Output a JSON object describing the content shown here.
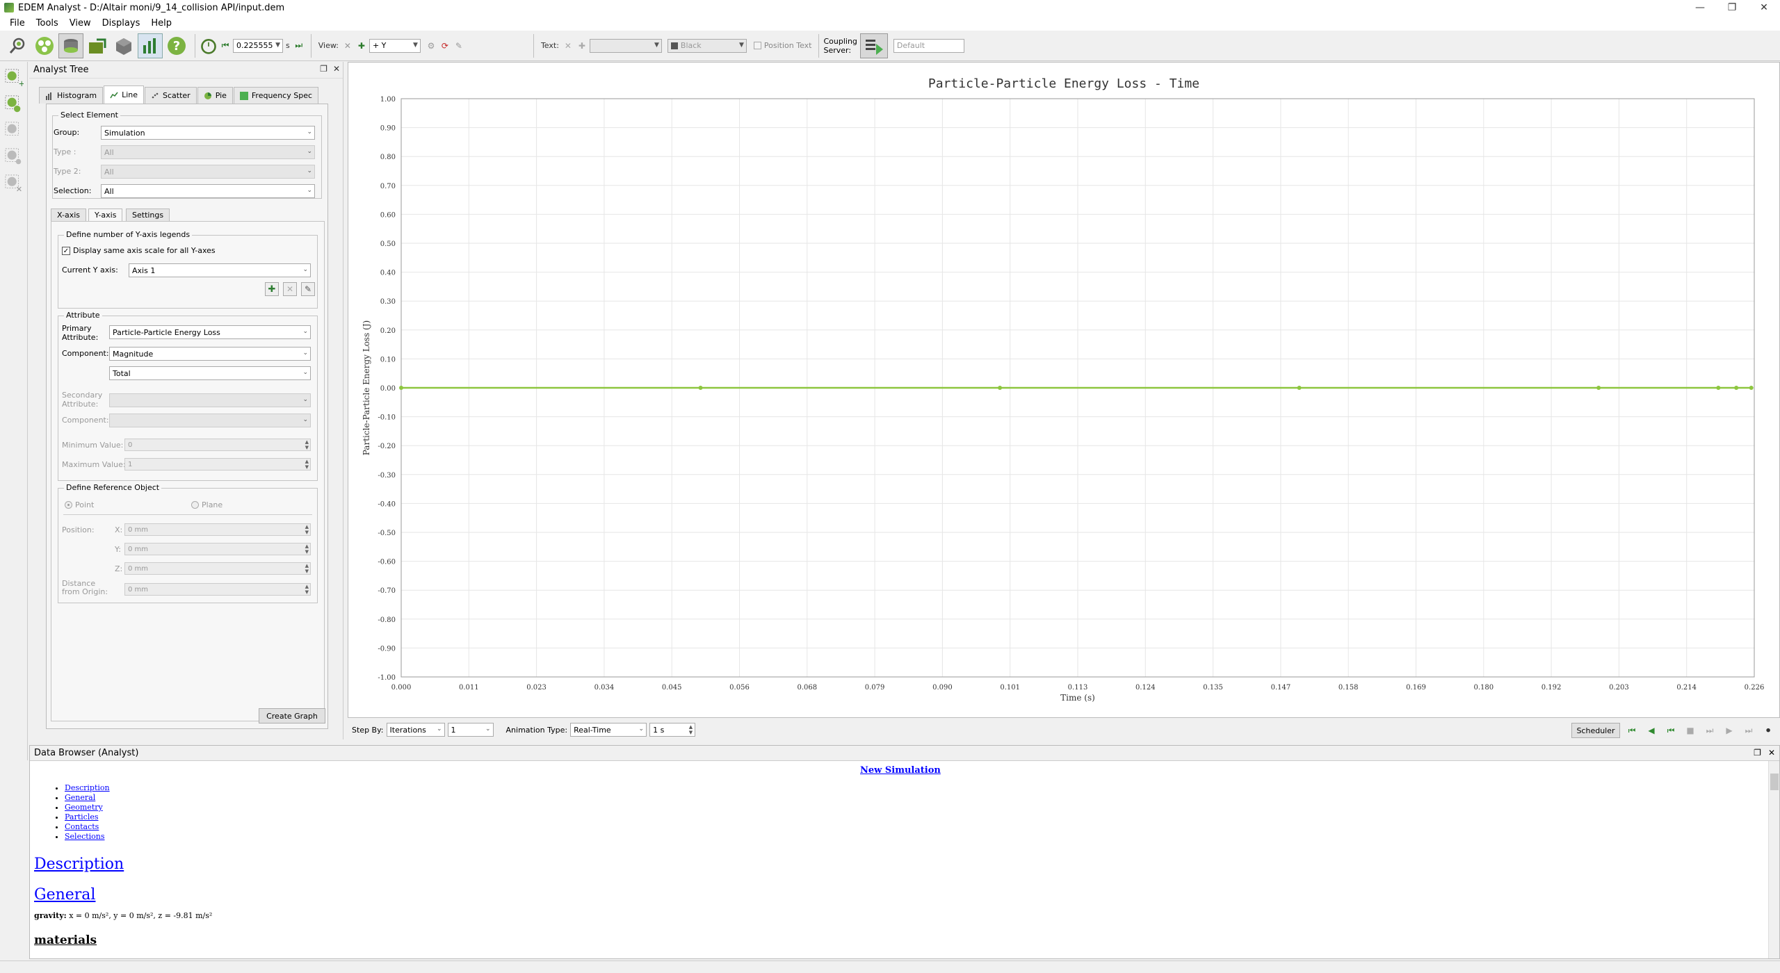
{
  "window": {
    "title": "EDEM Analyst - D:/Altair moni/9_14_collision API/input.dem"
  },
  "menu": [
    "File",
    "Tools",
    "View",
    "Displays",
    "Help"
  ],
  "toolbar": {
    "time_value": "0.225555",
    "time_unit": "s",
    "view_label": "View:",
    "view_axis": "+ Y",
    "text_label": "Text:",
    "color_value": "Black",
    "position_text_label": "Position Text",
    "coupling_label_1": "Coupling",
    "coupling_label_2": "Server:",
    "server_value": "Default"
  },
  "analyst_tree": {
    "title": "Analyst Tree",
    "tabs": [
      "Histogram",
      "Line",
      "Scatter",
      "Pie",
      "Frequency Spec"
    ],
    "active_tab": "Line",
    "select_element": {
      "title": "Select Element",
      "group_label": "Group:",
      "group_value": "Simulation",
      "type_label": "Type :",
      "type_value": "All",
      "type2_label": "Type 2:",
      "type2_value": "All",
      "selection_label": "Selection:",
      "selection_value": "All"
    },
    "axis_tabs": [
      "X-axis",
      "Y-axis",
      "Settings"
    ],
    "active_axis_tab": "Y-axis",
    "y_legends": {
      "title": "Define number of Y-axis legends",
      "checkbox_label": "Display same axis scale for all Y-axes",
      "current_label": "Current Y axis:",
      "current_value": "Axis 1"
    },
    "attribute": {
      "title": "Attribute",
      "primary_label_1": "Primary",
      "primary_label_2": "Attribute:",
      "primary_value": "Particle-Particle Energy Loss",
      "component_label": "Component:",
      "component_value": "Magnitude",
      "component2_value": "Total",
      "secondary_label_1": "Secondary",
      "secondary_label_2": "Attribute:",
      "secondary_component_label": "Component:",
      "min_label": "Minimum Value:",
      "min_value": "0",
      "max_label": "Maximum Value:",
      "max_value": "1"
    },
    "reference": {
      "title": "Define Reference Object",
      "point_label": "Point",
      "plane_label": "Plane",
      "position_label": "Position:",
      "x_label": "X:",
      "x_value": "0 mm",
      "y_label": "Y:",
      "y_value": "0 mm",
      "z_label": "Z:",
      "z_value": "0 mm",
      "distance_label_1": "Distance",
      "distance_label_2": "from Origin:",
      "distance_value": "0 mm"
    },
    "create_graph": "Create Graph"
  },
  "chart_data": {
    "type": "line",
    "title": "Particle-Particle Energy Loss - Time",
    "xlabel": "Time (s)",
    "ylabel": "Particle-Particle Energy Loss (J)",
    "xlim": [
      0.0,
      0.226
    ],
    "ylim": [
      -1.0,
      1.0
    ],
    "x_ticks": [
      "0.000",
      "0.011",
      "0.023",
      "0.034",
      "0.045",
      "0.056",
      "0.068",
      "0.079",
      "0.090",
      "0.101",
      "0.113",
      "0.124",
      "0.135",
      "0.147",
      "0.158",
      "0.169",
      "0.180",
      "0.192",
      "0.203",
      "0.214",
      "0.226"
    ],
    "y_ticks": [
      "1.00",
      "0.90",
      "0.80",
      "0.70",
      "0.60",
      "0.50",
      "0.40",
      "0.30",
      "0.20",
      "0.10",
      "0.00",
      "-0.10",
      "-0.20",
      "-0.30",
      "-0.40",
      "-0.50",
      "-0.60",
      "-0.70",
      "-0.80",
      "-0.90",
      "-1.00"
    ],
    "grid": true,
    "series": [
      {
        "color": "#8dc63f",
        "x": [
          0.0,
          0.05,
          0.1,
          0.15,
          0.2,
          0.22,
          0.223,
          0.2255
        ],
        "y": [
          0,
          0,
          0,
          0,
          0,
          0,
          0,
          0
        ]
      }
    ]
  },
  "playbar": {
    "step_by_label": "Step By:",
    "step_by_value": "Iterations",
    "step_value": "1",
    "anim_label": "Animation Type:",
    "anim_value": "Real-Time",
    "anim_interval": "1 s",
    "scheduler": "Scheduler"
  },
  "data_browser": {
    "title": "Data Browser (Analyst)",
    "heading": "New Simulation",
    "toc": [
      "Description",
      "General",
      "Geometry",
      "Particles",
      "Contacts",
      "Selections"
    ],
    "section_description": "Description",
    "section_general": "General",
    "gravity_label": "gravity:",
    "gravity_value": "x = 0 m/s², y = 0 m/s², z = -9.81 m/s²",
    "section_materials": "materials"
  }
}
